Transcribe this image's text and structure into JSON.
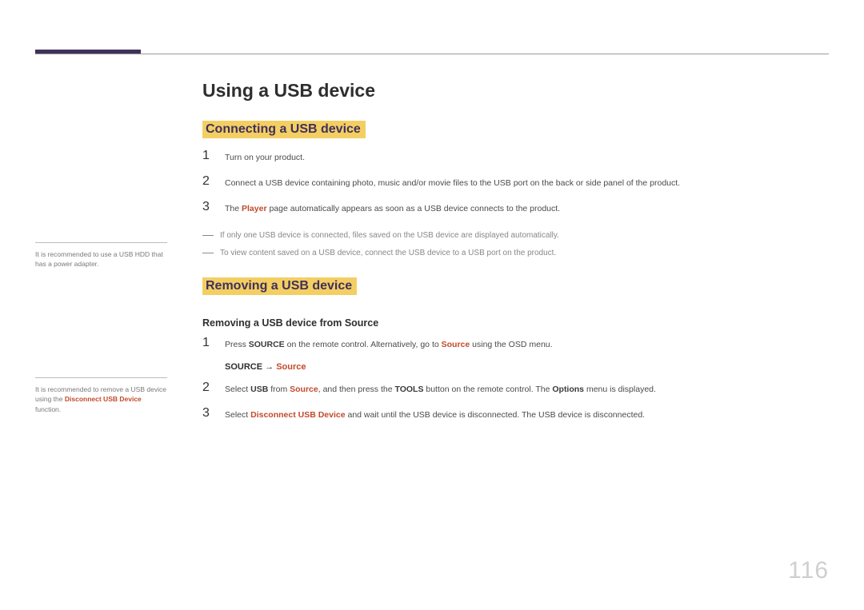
{
  "page_number": "116",
  "title": "Using a USB device",
  "section1": {
    "heading": "Connecting a USB device",
    "steps": {
      "n1": "1",
      "t1": "Turn on your product.",
      "n2": "2",
      "t2": "Connect a USB device containing photo, music and/or movie files to the USB port on the back or side panel of the product.",
      "n3": "3",
      "t3_pre": "The ",
      "t3_kw": "Player",
      "t3_post": " page automatically appears as soon as a USB device connects to the product."
    },
    "notes": {
      "a": "If only one USB device is connected, files saved on the USB device are displayed automatically.",
      "b": "To view content saved on a USB device, connect the USB device to a USB port on the product."
    }
  },
  "section2": {
    "heading": "Removing a USB device",
    "sub": "Removing a USB device from Source",
    "steps": {
      "n1": "1",
      "t1_pre": "Press ",
      "t1_b1": "SOURCE",
      "t1_mid": " on the remote control. Alternatively, go to ",
      "t1_a1": "Source",
      "t1_post": " using the OSD menu.",
      "path_b": "SOURCE",
      "path_arrow": " → ",
      "path_a": "Source",
      "n2": "2",
      "t2_pre": "Select ",
      "t2_b1": "USB",
      "t2_m1": " from ",
      "t2_a1": "Source",
      "t2_m2": ", and then press the ",
      "t2_b2": "TOOLS",
      "t2_m3": " button on the remote control. The ",
      "t2_b3": "Options",
      "t2_post": " menu is displayed.",
      "n3": "3",
      "t3_pre": "Select ",
      "t3_a1": "Disconnect USB Device",
      "t3_post": " and wait until the USB device is disconnected. The USB device is disconnected."
    }
  },
  "sidebar": {
    "note1": "It is recommended to use a USB HDD that has a power adapter.",
    "note2_pre": "It is recommended to remove a USB device using the ",
    "note2_kw": "Disconnect USB Device",
    "note2_post": " function."
  }
}
